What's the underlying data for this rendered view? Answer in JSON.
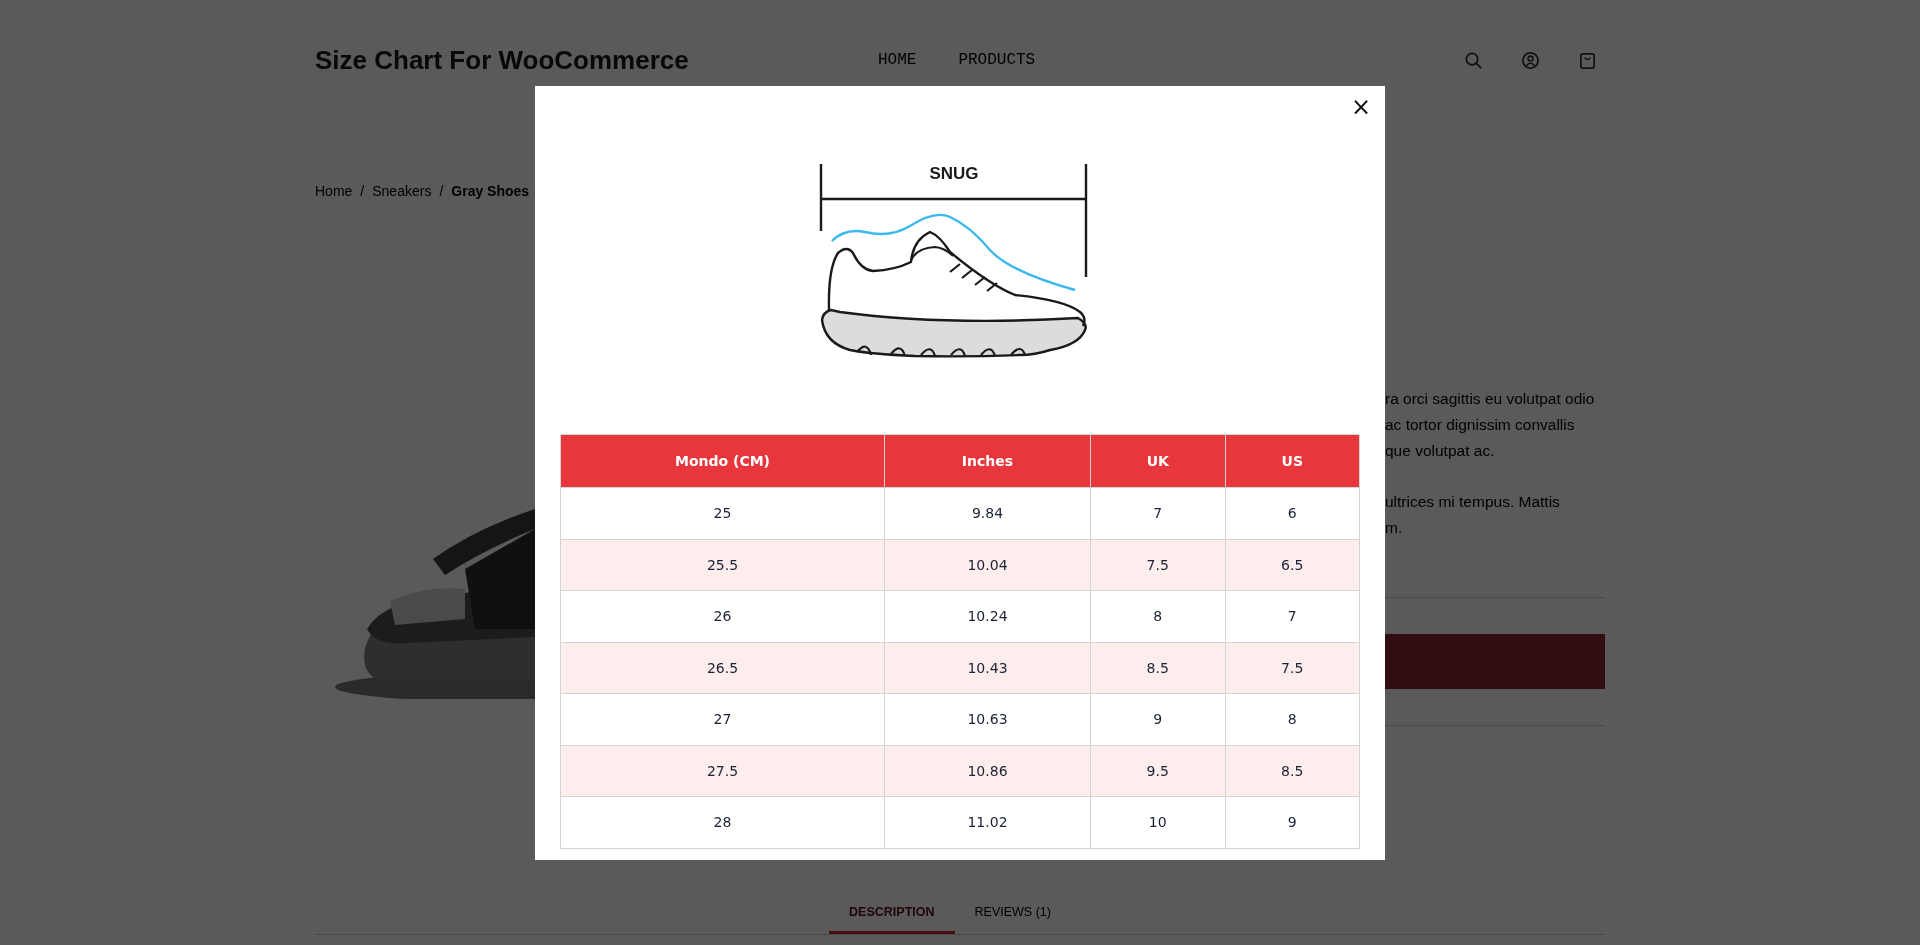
{
  "header": {
    "logo": "Size Chart For WooCommerce",
    "nav": [
      "HOME",
      "PRODUCTS"
    ]
  },
  "breadcrumb": [
    {
      "kind": "link",
      "text": "Home"
    },
    {
      "kind": "separator",
      "text": "/"
    },
    {
      "kind": "link",
      "text": "Sneakers"
    },
    {
      "kind": "separator",
      "text": "/"
    },
    {
      "kind": "current",
      "text": "Gray Shoes"
    }
  ],
  "product": {
    "description_lines": [
      "ra orci sagittis eu volutpat odio",
      "ac tortor dignissim convallis",
      "que volutpat ac."
    ],
    "description_lines_2": [
      "ultrices mi tempus. Mattis",
      "m."
    ]
  },
  "tabs": [
    {
      "label": "DESCRIPTION",
      "selected": true
    },
    {
      "label": "REVIEWS (1)",
      "selected": false
    }
  ],
  "size_chart_modal": {
    "close": "×",
    "fit_label": "SNUG",
    "table": {
      "columns": [
        "Mondo (CM)",
        "Inches",
        "UK",
        "US"
      ],
      "rows": [
        [
          "25",
          "9.84",
          "7",
          "6"
        ],
        [
          "25.5",
          "10.04",
          "7.5",
          "6.5"
        ],
        [
          "26",
          "10.24",
          "8",
          "7"
        ],
        [
          "26.5",
          "10.43",
          "8.5",
          "7.5"
        ],
        [
          "27",
          "10.63",
          "9",
          "8"
        ],
        [
          "27.5",
          "10.86",
          "9.5",
          "8.5"
        ],
        [
          "28",
          "11.02",
          "10",
          "9"
        ]
      ]
    }
  }
}
